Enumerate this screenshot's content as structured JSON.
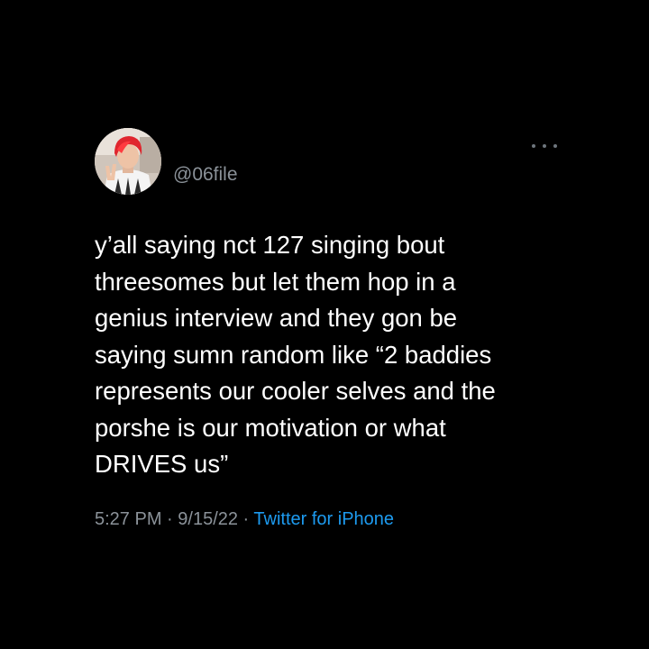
{
  "tweet": {
    "handle": "@06file",
    "lines": [
      "y’all saying nct 127 singing bout",
      "threesomes but let them hop in a",
      "genius interview and they gon be",
      "saying sumn random like “2 baddies",
      "represents our cooler selves and the",
      "porshe is our motivation or what",
      "DRIVES us”"
    ],
    "time": "5:27 PM",
    "date": "9/15/22",
    "separator": " · ",
    "source": "Twitter for iPhone"
  },
  "icons": {
    "avatar": "profile-photo",
    "more": "more-options-icon"
  },
  "colors": {
    "background": "#000000",
    "text": "#ffffff",
    "secondary": "#8b9299",
    "link": "#1d9bf0"
  }
}
